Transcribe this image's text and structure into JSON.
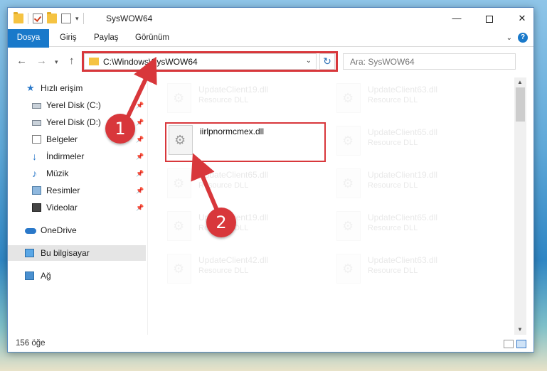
{
  "window": {
    "title": "SysWOW64",
    "controls": {
      "minimize": "—",
      "close": "✕"
    }
  },
  "ribbon": {
    "tabs": [
      "Dosya",
      "Giriş",
      "Paylaş",
      "Görünüm"
    ],
    "help": "?"
  },
  "nav": {
    "back": "←",
    "forward": "→",
    "up": "↑",
    "dropdown": "▾",
    "address": "C:\\Windows\\SysWOW64",
    "refresh": "↻",
    "search_placeholder": "Ara: SysWOW64"
  },
  "sidebar": {
    "items": [
      {
        "label": "Hızlı erişim"
      },
      {
        "label": "Yerel Disk (C:)"
      },
      {
        "label": "Yerel Disk (D:)"
      },
      {
        "label": "Belgeler"
      },
      {
        "label": "İndirmeler"
      },
      {
        "label": "Müzik"
      },
      {
        "label": "Resimler"
      },
      {
        "label": "Videolar"
      },
      {
        "label": "OneDrive"
      },
      {
        "label": "Bu bilgisayar"
      },
      {
        "label": "Ağ"
      }
    ],
    "pin_glyph": "📌"
  },
  "files": {
    "highlighted": {
      "name": "iirlpnormcmex.dll"
    },
    "faded": [
      {
        "name": "UpdateClient19.dll",
        "desc": "Resource DLL"
      },
      {
        "name": "UpdateClient63.dll",
        "desc": "Resource DLL"
      },
      {
        "name": "UpdateClient65.dll",
        "desc": "Resource DLL"
      },
      {
        "name": "UpdateClient65.dll",
        "desc": "Resource DLL"
      },
      {
        "name": "UpdateClient19.dll",
        "desc": "Resource DLL"
      },
      {
        "name": "UpdateClient19.dll",
        "desc": "Resource DLL"
      },
      {
        "name": "UpdateClient65.dll",
        "desc": "Resource DLL"
      },
      {
        "name": "UpdateClient42.dll",
        "desc": "Resource DLL"
      },
      {
        "name": "UpdateClient63.dll",
        "desc": "Resource DLL"
      }
    ]
  },
  "status": {
    "count": "156 öğe"
  },
  "annotations": {
    "step1": "1",
    "step2": "2",
    "color": "#d8373b"
  }
}
